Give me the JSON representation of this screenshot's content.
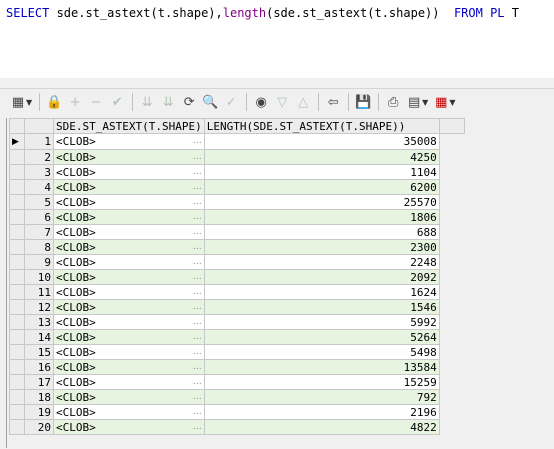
{
  "editor": {
    "select_kw": "SELECT",
    "col1_text": " sde.st_astext(t.shape),",
    "length_fn": "length",
    "col2_text": "(sde.st_astext(t.shape))  ",
    "from_kw": "FROM",
    "table_kw": " PL",
    "alias": " T"
  },
  "toolbar": {
    "icons": [
      "grid-menu-icon",
      "lock-icon",
      "add-row-icon",
      "delete-row-icon",
      "post-changes-icon",
      "fetch-next-icon",
      "fetch-last-icon",
      "refresh-icon",
      "find-icon",
      "clear-icon",
      "query-by-example-icon",
      "previous-icon",
      "next-icon",
      "export-icon",
      "save-icon",
      "print-icon",
      "chart-icon",
      "table-view-icon"
    ]
  },
  "grid": {
    "columns": [
      "SDE.ST_ASTEXT(T.SHAPE)",
      "LENGTH(SDE.ST_ASTEXT(T.SHAPE))"
    ],
    "rows": [
      {
        "n": "1",
        "shape": "<CLOB>",
        "len": "35008"
      },
      {
        "n": "2",
        "shape": "<CLOB>",
        "len": "4250"
      },
      {
        "n": "3",
        "shape": "<CLOB>",
        "len": "1104"
      },
      {
        "n": "4",
        "shape": "<CLOB>",
        "len": "6200"
      },
      {
        "n": "5",
        "shape": "<CLOB>",
        "len": "25570"
      },
      {
        "n": "6",
        "shape": "<CLOB>",
        "len": "1806"
      },
      {
        "n": "7",
        "shape": "<CLOB>",
        "len": "688"
      },
      {
        "n": "8",
        "shape": "<CLOB>",
        "len": "2300"
      },
      {
        "n": "9",
        "shape": "<CLOB>",
        "len": "2248"
      },
      {
        "n": "10",
        "shape": "<CLOB>",
        "len": "2092"
      },
      {
        "n": "11",
        "shape": "<CLOB>",
        "len": "1624"
      },
      {
        "n": "12",
        "shape": "<CLOB>",
        "len": "1546"
      },
      {
        "n": "13",
        "shape": "<CLOB>",
        "len": "5992"
      },
      {
        "n": "14",
        "shape": "<CLOB>",
        "len": "5264"
      },
      {
        "n": "15",
        "shape": "<CLOB>",
        "len": "5498"
      },
      {
        "n": "16",
        "shape": "<CLOB>",
        "len": "13584"
      },
      {
        "n": "17",
        "shape": "<CLOB>",
        "len": "15259"
      },
      {
        "n": "18",
        "shape": "<CLOB>",
        "len": "792"
      },
      {
        "n": "19",
        "shape": "<CLOB>",
        "len": "2196"
      },
      {
        "n": "20",
        "shape": "<CLOB>",
        "len": "4822"
      }
    ]
  },
  "colors": {
    "keyword": "#0000c8",
    "function": "#800080",
    "alt_row": "#e6f4e0"
  }
}
